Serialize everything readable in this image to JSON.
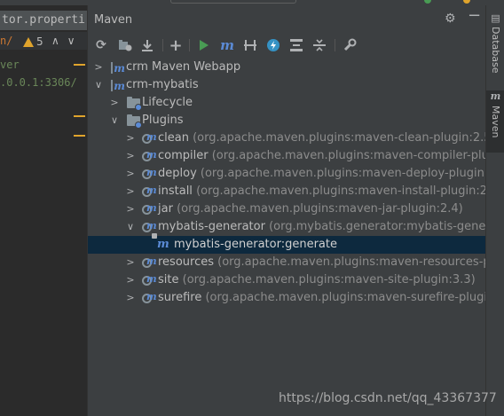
{
  "editor": {
    "tab_label": "tor.properti",
    "warning_prefix": "n/",
    "warning_count": "5",
    "nav_arrows": "∧∨",
    "code_line_1": "ver",
    "code_line_2": ".0.0.1:3306/"
  },
  "maven": {
    "title": "Maven",
    "tree": {
      "project_1": "crm Maven Webapp",
      "project_2": "crm-mybatis",
      "lifecycle": "Lifecycle",
      "plugins": "Plugins",
      "plugin_items": [
        {
          "name": "clean",
          "detail": "(org.apache.maven.plugins:maven-clean-plugin:2.5)"
        },
        {
          "name": "compiler",
          "detail": "(org.apache.maven.plugins:maven-compiler-plugin:"
        },
        {
          "name": "deploy",
          "detail": "(org.apache.maven.plugins:maven-deploy-plugin:2.7)"
        },
        {
          "name": "install",
          "detail": "(org.apache.maven.plugins:maven-install-plugin:2.4)"
        },
        {
          "name": "jar",
          "detail": "(org.apache.maven.plugins:maven-jar-plugin:2.4)"
        },
        {
          "name": "mybatis-generator",
          "detail": "(org.mybatis.generator:mybatis-generato"
        },
        {
          "name": "resources",
          "detail": "(org.apache.maven.plugins:maven-resources-plugi"
        },
        {
          "name": "site",
          "detail": "(org.apache.maven.plugins:maven-site-plugin:3.3)"
        },
        {
          "name": "surefire",
          "detail": "(org.apache.maven.plugins:maven-surefire-plugin:2.1"
        }
      ],
      "goal": "mybatis-generator:generate"
    }
  },
  "side_stripe": {
    "database": "Database",
    "maven": "Maven"
  },
  "watermark": "https://blog.csdn.net/qq_43367377",
  "colors": {
    "panel_bg": "#3c3f41",
    "editor_bg": "#2b2b2b",
    "selection": "#0d293e",
    "text": "#bbbbbb",
    "dim_text": "#8c8c8c",
    "maven_blue": "#5b8bd6",
    "run_green": "#499c54"
  }
}
